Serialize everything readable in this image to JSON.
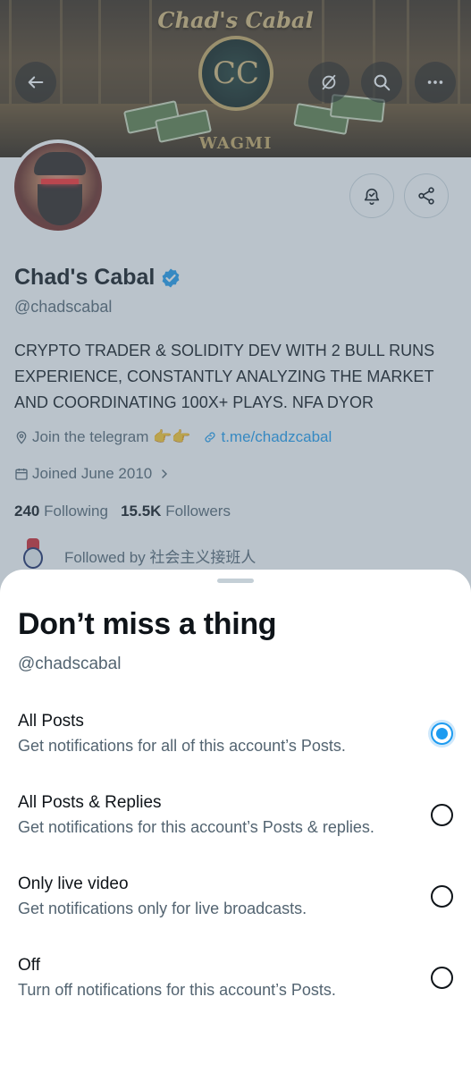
{
  "banner": {
    "title": "Chad's Cabal",
    "emblem": "CC",
    "subtitle": "WAGMI"
  },
  "header": {
    "back_icon": "arrow-left-icon",
    "grok_icon": "grok-icon",
    "search_icon": "search-icon",
    "more_icon": "more-horizontal-icon"
  },
  "profile": {
    "name": "Chad's Cabal",
    "handle": "@chadscabal",
    "verified": true,
    "bio": "CRYPTO TRADER & SOLIDITY DEV WITH 2 BULL RUNS EXPERIENCE, CONSTANTLY ANALYZING THE MARKET AND COORDINATING 100X+ PLAYS. NFA DYOR",
    "location": "Join the telegram 👉👉",
    "link": "t.me/chadzcabal",
    "joined": "Joined June 2010",
    "following_count": "240",
    "following_label": "Following",
    "followers_count": "15.5K",
    "followers_label": "Followers",
    "followed_by": "Followed by 社会主义接班人"
  },
  "sheet": {
    "title": "Don’t miss a thing",
    "subtitle": "@chadscabal",
    "options": [
      {
        "label": "All Posts",
        "description": "Get notifications for all of this account’s Posts.",
        "selected": true
      },
      {
        "label": "All Posts & Replies",
        "description": "Get notifications for this account’s Posts & replies.",
        "selected": false
      },
      {
        "label": "Only live video",
        "description": "Get notifications only for live broadcasts.",
        "selected": false
      },
      {
        "label": "Off",
        "description": "Turn off notifications for this account’s Posts.",
        "selected": false
      }
    ]
  },
  "colors": {
    "accent": "#1d9bf0",
    "text_primary": "#0f1419",
    "text_secondary": "#536471",
    "overlay": "rgba(91,112,131,.42)"
  }
}
